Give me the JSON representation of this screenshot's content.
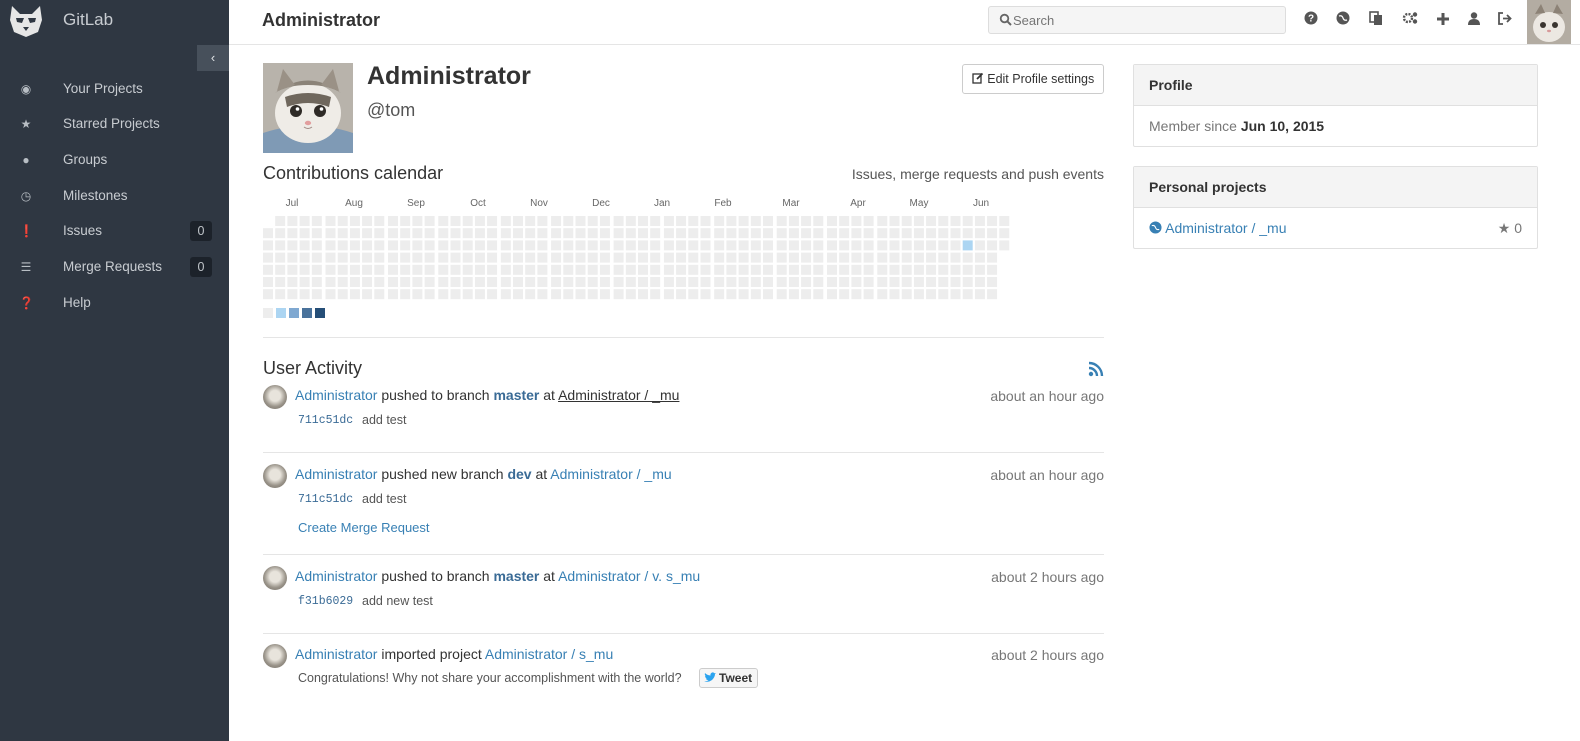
{
  "app": {
    "brand": "GitLab",
    "collapse_icon": "chevron-left-icon"
  },
  "sidebar": {
    "items": [
      {
        "label": "Your Projects",
        "icon": "dashboard-icon"
      },
      {
        "label": "Starred Projects",
        "icon": "star-icon"
      },
      {
        "label": "Groups",
        "icon": "group-icon"
      },
      {
        "label": "Milestones",
        "icon": "clock-icon"
      },
      {
        "label": "Issues",
        "icon": "exclamation-circle-icon",
        "count": "0"
      },
      {
        "label": "Merge Requests",
        "icon": "list-icon",
        "count": "0"
      },
      {
        "label": "Help",
        "icon": "question-circle-icon"
      }
    ]
  },
  "header": {
    "title": "Administrator",
    "search_placeholder": "Search",
    "icons": [
      "question-circle-icon",
      "globe-icon",
      "copy-icon",
      "cogs-icon",
      "plus-icon",
      "user-icon",
      "sign-out-icon"
    ]
  },
  "profile": {
    "name": "Administrator",
    "username": "@tom",
    "edit_button": "Edit Profile settings"
  },
  "calendar": {
    "title": "Contributions calendar",
    "subtitle": "Issues, merge requests and push events",
    "months": [
      "Jul",
      "Aug",
      "Sep",
      "Oct",
      "Nov",
      "Dec",
      "Jan",
      "Feb",
      "Mar",
      "Apr",
      "May",
      "Jun"
    ],
    "empty_color": "#ededed",
    "legend_colors": [
      "#ededed",
      "#acd5f2",
      "#7fa8d1",
      "#49729b",
      "#254e77"
    ],
    "active_cell": {
      "month": "Jun",
      "level": 1
    }
  },
  "activity": {
    "title": "User Activity",
    "rss_icon": "rss-icon",
    "events": [
      {
        "author": "Administrator",
        "action": "pushed to branch",
        "branch": "master",
        "at": "at",
        "project": "Administrator /              _mu",
        "time": "about an hour ago",
        "sha": "711c51dc",
        "message": "add test"
      },
      {
        "author": "Administrator",
        "action": "pushed new branch",
        "branch": "dev",
        "at": "at",
        "project": "Administrator /              _mu",
        "time": "about an hour ago",
        "sha": "711c51dc",
        "message": "add test",
        "merge_request": "Create Merge Request"
      },
      {
        "author": "Administrator",
        "action": "pushed to branch",
        "branch": "master",
        "at": "at",
        "project": "Administrator / v.          s_mu",
        "time": "about 2 hours ago",
        "sha": "f31b6029",
        "message": "add new test"
      },
      {
        "author": "Administrator",
        "action": "imported project",
        "project": "Administrator /           s_mu",
        "time": "about 2 hours ago",
        "congrats": "Congratulations! Why not share your accomplishment with the world?",
        "tweet": "Tweet"
      }
    ]
  },
  "right": {
    "profile_panel": {
      "title": "Profile",
      "member_since_label": "Member since",
      "member_since_date": "Jun 10, 2015"
    },
    "projects_panel": {
      "title": "Personal projects",
      "project": "Administrator /              _mu",
      "stars": "0"
    }
  }
}
